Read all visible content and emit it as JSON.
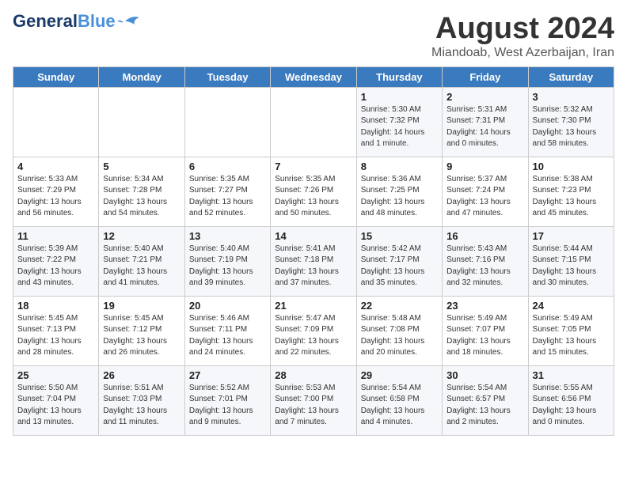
{
  "logo": {
    "line1": "General",
    "line2": "Blue"
  },
  "title": "August 2024",
  "subtitle": "Miandoab, West Azerbaijan, Iran",
  "weekdays": [
    "Sunday",
    "Monday",
    "Tuesday",
    "Wednesday",
    "Thursday",
    "Friday",
    "Saturday"
  ],
  "weeks": [
    [
      {
        "day": "",
        "info": ""
      },
      {
        "day": "",
        "info": ""
      },
      {
        "day": "",
        "info": ""
      },
      {
        "day": "",
        "info": ""
      },
      {
        "day": "1",
        "info": "Sunrise: 5:30 AM\nSunset: 7:32 PM\nDaylight: 14 hours\nand 1 minute."
      },
      {
        "day": "2",
        "info": "Sunrise: 5:31 AM\nSunset: 7:31 PM\nDaylight: 14 hours\nand 0 minutes."
      },
      {
        "day": "3",
        "info": "Sunrise: 5:32 AM\nSunset: 7:30 PM\nDaylight: 13 hours\nand 58 minutes."
      }
    ],
    [
      {
        "day": "4",
        "info": "Sunrise: 5:33 AM\nSunset: 7:29 PM\nDaylight: 13 hours\nand 56 minutes."
      },
      {
        "day": "5",
        "info": "Sunrise: 5:34 AM\nSunset: 7:28 PM\nDaylight: 13 hours\nand 54 minutes."
      },
      {
        "day": "6",
        "info": "Sunrise: 5:35 AM\nSunset: 7:27 PM\nDaylight: 13 hours\nand 52 minutes."
      },
      {
        "day": "7",
        "info": "Sunrise: 5:35 AM\nSunset: 7:26 PM\nDaylight: 13 hours\nand 50 minutes."
      },
      {
        "day": "8",
        "info": "Sunrise: 5:36 AM\nSunset: 7:25 PM\nDaylight: 13 hours\nand 48 minutes."
      },
      {
        "day": "9",
        "info": "Sunrise: 5:37 AM\nSunset: 7:24 PM\nDaylight: 13 hours\nand 47 minutes."
      },
      {
        "day": "10",
        "info": "Sunrise: 5:38 AM\nSunset: 7:23 PM\nDaylight: 13 hours\nand 45 minutes."
      }
    ],
    [
      {
        "day": "11",
        "info": "Sunrise: 5:39 AM\nSunset: 7:22 PM\nDaylight: 13 hours\nand 43 minutes."
      },
      {
        "day": "12",
        "info": "Sunrise: 5:40 AM\nSunset: 7:21 PM\nDaylight: 13 hours\nand 41 minutes."
      },
      {
        "day": "13",
        "info": "Sunrise: 5:40 AM\nSunset: 7:19 PM\nDaylight: 13 hours\nand 39 minutes."
      },
      {
        "day": "14",
        "info": "Sunrise: 5:41 AM\nSunset: 7:18 PM\nDaylight: 13 hours\nand 37 minutes."
      },
      {
        "day": "15",
        "info": "Sunrise: 5:42 AM\nSunset: 7:17 PM\nDaylight: 13 hours\nand 35 minutes."
      },
      {
        "day": "16",
        "info": "Sunrise: 5:43 AM\nSunset: 7:16 PM\nDaylight: 13 hours\nand 32 minutes."
      },
      {
        "day": "17",
        "info": "Sunrise: 5:44 AM\nSunset: 7:15 PM\nDaylight: 13 hours\nand 30 minutes."
      }
    ],
    [
      {
        "day": "18",
        "info": "Sunrise: 5:45 AM\nSunset: 7:13 PM\nDaylight: 13 hours\nand 28 minutes."
      },
      {
        "day": "19",
        "info": "Sunrise: 5:45 AM\nSunset: 7:12 PM\nDaylight: 13 hours\nand 26 minutes."
      },
      {
        "day": "20",
        "info": "Sunrise: 5:46 AM\nSunset: 7:11 PM\nDaylight: 13 hours\nand 24 minutes."
      },
      {
        "day": "21",
        "info": "Sunrise: 5:47 AM\nSunset: 7:09 PM\nDaylight: 13 hours\nand 22 minutes."
      },
      {
        "day": "22",
        "info": "Sunrise: 5:48 AM\nSunset: 7:08 PM\nDaylight: 13 hours\nand 20 minutes."
      },
      {
        "day": "23",
        "info": "Sunrise: 5:49 AM\nSunset: 7:07 PM\nDaylight: 13 hours\nand 18 minutes."
      },
      {
        "day": "24",
        "info": "Sunrise: 5:49 AM\nSunset: 7:05 PM\nDaylight: 13 hours\nand 15 minutes."
      }
    ],
    [
      {
        "day": "25",
        "info": "Sunrise: 5:50 AM\nSunset: 7:04 PM\nDaylight: 13 hours\nand 13 minutes."
      },
      {
        "day": "26",
        "info": "Sunrise: 5:51 AM\nSunset: 7:03 PM\nDaylight: 13 hours\nand 11 minutes."
      },
      {
        "day": "27",
        "info": "Sunrise: 5:52 AM\nSunset: 7:01 PM\nDaylight: 13 hours\nand 9 minutes."
      },
      {
        "day": "28",
        "info": "Sunrise: 5:53 AM\nSunset: 7:00 PM\nDaylight: 13 hours\nand 7 minutes."
      },
      {
        "day": "29",
        "info": "Sunrise: 5:54 AM\nSunset: 6:58 PM\nDaylight: 13 hours\nand 4 minutes."
      },
      {
        "day": "30",
        "info": "Sunrise: 5:54 AM\nSunset: 6:57 PM\nDaylight: 13 hours\nand 2 minutes."
      },
      {
        "day": "31",
        "info": "Sunrise: 5:55 AM\nSunset: 6:56 PM\nDaylight: 13 hours\nand 0 minutes."
      }
    ]
  ]
}
